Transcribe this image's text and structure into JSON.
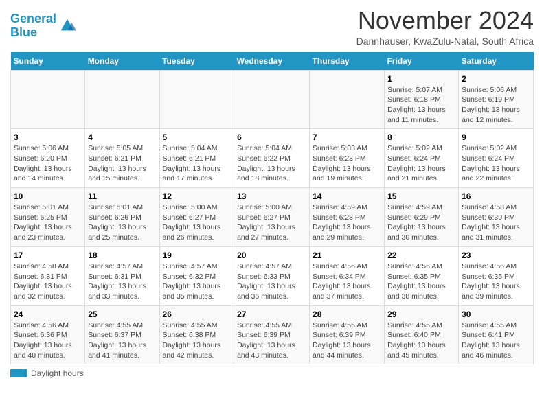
{
  "header": {
    "logo_line1": "General",
    "logo_line2": "Blue",
    "title": "November 2024",
    "subtitle": "Dannhauser, KwaZulu-Natal, South Africa"
  },
  "days_of_week": [
    "Sunday",
    "Monday",
    "Tuesday",
    "Wednesday",
    "Thursday",
    "Friday",
    "Saturday"
  ],
  "weeks": [
    [
      {
        "day": "",
        "info": ""
      },
      {
        "day": "",
        "info": ""
      },
      {
        "day": "",
        "info": ""
      },
      {
        "day": "",
        "info": ""
      },
      {
        "day": "",
        "info": ""
      },
      {
        "day": "1",
        "info": "Sunrise: 5:07 AM\nSunset: 6:18 PM\nDaylight: 13 hours and 11 minutes."
      },
      {
        "day": "2",
        "info": "Sunrise: 5:06 AM\nSunset: 6:19 PM\nDaylight: 13 hours and 12 minutes."
      }
    ],
    [
      {
        "day": "3",
        "info": "Sunrise: 5:06 AM\nSunset: 6:20 PM\nDaylight: 13 hours and 14 minutes."
      },
      {
        "day": "4",
        "info": "Sunrise: 5:05 AM\nSunset: 6:21 PM\nDaylight: 13 hours and 15 minutes."
      },
      {
        "day": "5",
        "info": "Sunrise: 5:04 AM\nSunset: 6:21 PM\nDaylight: 13 hours and 17 minutes."
      },
      {
        "day": "6",
        "info": "Sunrise: 5:04 AM\nSunset: 6:22 PM\nDaylight: 13 hours and 18 minutes."
      },
      {
        "day": "7",
        "info": "Sunrise: 5:03 AM\nSunset: 6:23 PM\nDaylight: 13 hours and 19 minutes."
      },
      {
        "day": "8",
        "info": "Sunrise: 5:02 AM\nSunset: 6:24 PM\nDaylight: 13 hours and 21 minutes."
      },
      {
        "day": "9",
        "info": "Sunrise: 5:02 AM\nSunset: 6:24 PM\nDaylight: 13 hours and 22 minutes."
      }
    ],
    [
      {
        "day": "10",
        "info": "Sunrise: 5:01 AM\nSunset: 6:25 PM\nDaylight: 13 hours and 23 minutes."
      },
      {
        "day": "11",
        "info": "Sunrise: 5:01 AM\nSunset: 6:26 PM\nDaylight: 13 hours and 25 minutes."
      },
      {
        "day": "12",
        "info": "Sunrise: 5:00 AM\nSunset: 6:27 PM\nDaylight: 13 hours and 26 minutes."
      },
      {
        "day": "13",
        "info": "Sunrise: 5:00 AM\nSunset: 6:27 PM\nDaylight: 13 hours and 27 minutes."
      },
      {
        "day": "14",
        "info": "Sunrise: 4:59 AM\nSunset: 6:28 PM\nDaylight: 13 hours and 29 minutes."
      },
      {
        "day": "15",
        "info": "Sunrise: 4:59 AM\nSunset: 6:29 PM\nDaylight: 13 hours and 30 minutes."
      },
      {
        "day": "16",
        "info": "Sunrise: 4:58 AM\nSunset: 6:30 PM\nDaylight: 13 hours and 31 minutes."
      }
    ],
    [
      {
        "day": "17",
        "info": "Sunrise: 4:58 AM\nSunset: 6:31 PM\nDaylight: 13 hours and 32 minutes."
      },
      {
        "day": "18",
        "info": "Sunrise: 4:57 AM\nSunset: 6:31 PM\nDaylight: 13 hours and 33 minutes."
      },
      {
        "day": "19",
        "info": "Sunrise: 4:57 AM\nSunset: 6:32 PM\nDaylight: 13 hours and 35 minutes."
      },
      {
        "day": "20",
        "info": "Sunrise: 4:57 AM\nSunset: 6:33 PM\nDaylight: 13 hours and 36 minutes."
      },
      {
        "day": "21",
        "info": "Sunrise: 4:56 AM\nSunset: 6:34 PM\nDaylight: 13 hours and 37 minutes."
      },
      {
        "day": "22",
        "info": "Sunrise: 4:56 AM\nSunset: 6:35 PM\nDaylight: 13 hours and 38 minutes."
      },
      {
        "day": "23",
        "info": "Sunrise: 4:56 AM\nSunset: 6:35 PM\nDaylight: 13 hours and 39 minutes."
      }
    ],
    [
      {
        "day": "24",
        "info": "Sunrise: 4:56 AM\nSunset: 6:36 PM\nDaylight: 13 hours and 40 minutes."
      },
      {
        "day": "25",
        "info": "Sunrise: 4:55 AM\nSunset: 6:37 PM\nDaylight: 13 hours and 41 minutes."
      },
      {
        "day": "26",
        "info": "Sunrise: 4:55 AM\nSunset: 6:38 PM\nDaylight: 13 hours and 42 minutes."
      },
      {
        "day": "27",
        "info": "Sunrise: 4:55 AM\nSunset: 6:39 PM\nDaylight: 13 hours and 43 minutes."
      },
      {
        "day": "28",
        "info": "Sunrise: 4:55 AM\nSunset: 6:39 PM\nDaylight: 13 hours and 44 minutes."
      },
      {
        "day": "29",
        "info": "Sunrise: 4:55 AM\nSunset: 6:40 PM\nDaylight: 13 hours and 45 minutes."
      },
      {
        "day": "30",
        "info": "Sunrise: 4:55 AM\nSunset: 6:41 PM\nDaylight: 13 hours and 46 minutes."
      }
    ]
  ],
  "footer": {
    "legend_label": "Daylight hours"
  },
  "colors": {
    "header_bg": "#2196c4",
    "header_text": "#ffffff",
    "accent": "#2196c4"
  }
}
